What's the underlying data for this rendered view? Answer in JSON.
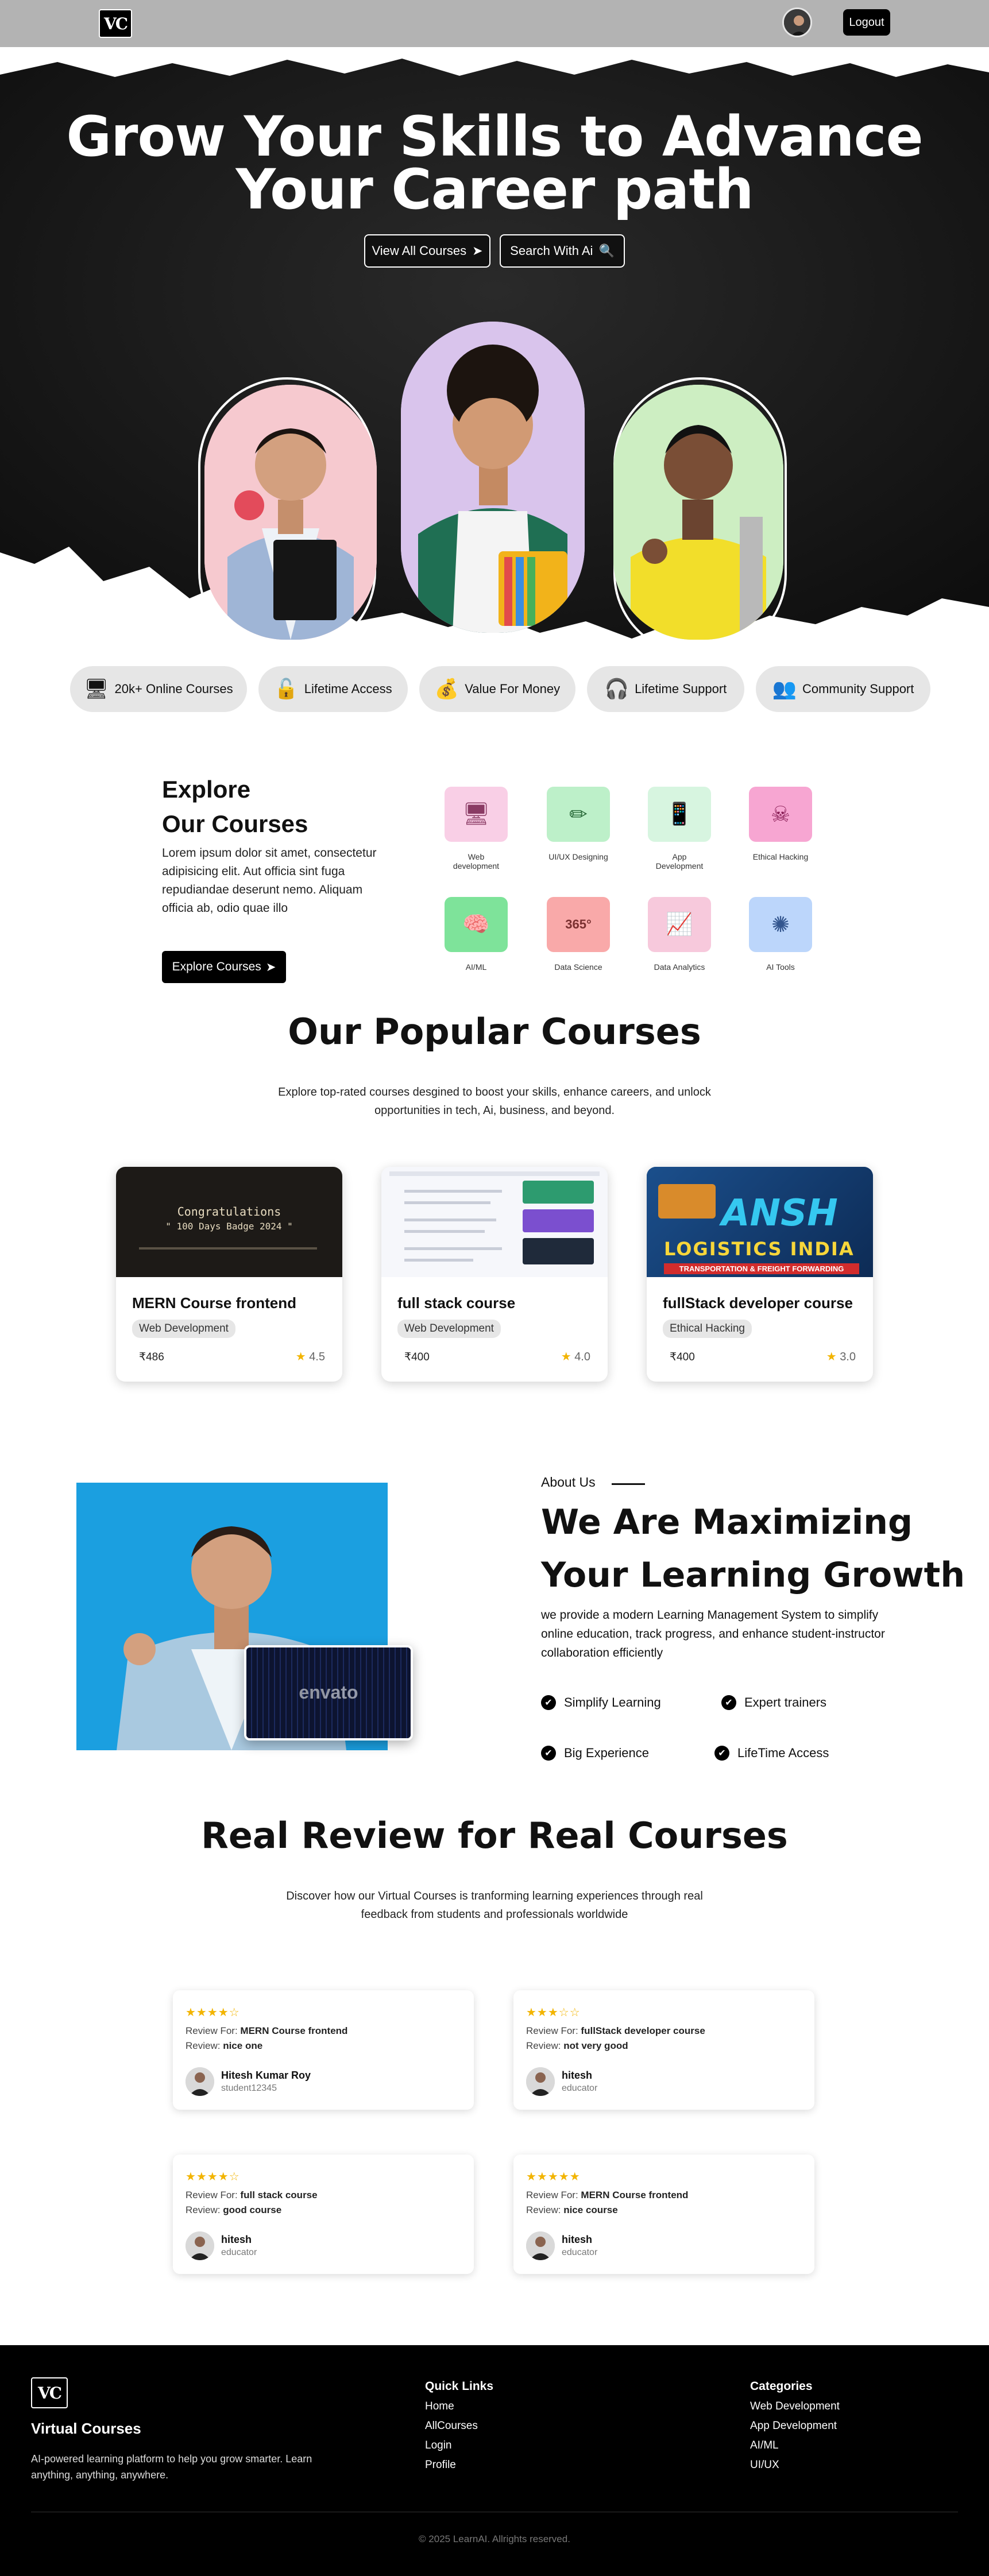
{
  "header": {
    "logo_text": "VC",
    "logout_label": "Logout"
  },
  "hero": {
    "title_line1": "Grow Your Skills to Advance",
    "title_line2": "Your Career path",
    "view_all_label": "View All Courses",
    "search_ai_label": "Search With Ai"
  },
  "features": [
    {
      "icon": "courses-icon",
      "label": "20k+ Online Courses"
    },
    {
      "icon": "lock-icon",
      "label": "Lifetime Access"
    },
    {
      "icon": "money-bag-icon",
      "label": "Value For Money"
    },
    {
      "icon": "headset-icon",
      "label": "Lifetime Support"
    },
    {
      "icon": "community-icon",
      "label": "Community Support"
    }
  ],
  "explore": {
    "title_line1": "Explore",
    "title_line2": "Our Courses",
    "description": "Lorem ipsum dolor sit amet, consectetur adipisicing elit. Aut officia sint fuga repudiandae deserunt nemo. Aliquam officia ab, odio quae illo",
    "button_label": "Explore Courses",
    "categories": [
      {
        "label": "Web development",
        "color": "#f9cfe6",
        "icon_color": "#8a3b64"
      },
      {
        "label": "UI/UX Designing",
        "color": "#bdf0c9",
        "icon_color": "#2a6b3a"
      },
      {
        "label": "App Development",
        "color": "#d7f5e0",
        "icon_color": "#3c7a50"
      },
      {
        "label": "Ethical Hacking",
        "color": "#f7a6d2",
        "icon_color": "#8a1f57"
      },
      {
        "label": "AI/ML",
        "color": "#7ee39a",
        "icon_color": "#1d6b34"
      },
      {
        "label": "Data Science",
        "color": "#f9a9a9",
        "icon_color": "#7a3030"
      },
      {
        "label": "Data Analytics",
        "color": "#f7c9dc",
        "icon_color": "#6b3a4d"
      },
      {
        "label": "AI Tools",
        "color": "#bcd6fb",
        "icon_color": "#33568f"
      }
    ]
  },
  "popular": {
    "title": "Our Popular Courses",
    "subtitle": "Explore top-rated courses desgined to boost your skills, enhance careers, and unlock opportunities in tech, Ai, business, and beyond.",
    "courses": [
      {
        "title": "MERN Course frontend",
        "category": "Web Development",
        "price": "₹486",
        "rating": "4.5"
      },
      {
        "title": "full stack course",
        "category": "Web Development",
        "price": "₹400",
        "rating": "4.0"
      },
      {
        "title": "fullStack developer course",
        "category": "Ethical Hacking",
        "price": "₹400",
        "rating": "3.0"
      }
    ],
    "thumb1_text1": "Congratulations",
    "thumb1_text2": "\" 100 Days Badge 2024 \"",
    "thumb3_brand": "ANSH",
    "thumb3_line": "LOGISTICS INDIA",
    "thumb3_tag": "TRANSPORTATION & FREIGHT FORWARDING"
  },
  "about": {
    "label": "About Us",
    "title_line1": "We Are Maximizing",
    "title_line2": "Your Learning Growth",
    "description": "we provide a modern Learning Management System to simplify online education, track progress, and enhance student-instructor collaboration efficiently",
    "points": [
      "Simplify Learning",
      "Expert trainers",
      "Big Experience",
      "LifeTime Access"
    ],
    "overlay_text": "envato"
  },
  "reviews": {
    "title": "Real Review for Real Courses",
    "subtitle": "Discover how our Virtual Courses is tranforming learning experiences through real feedback from students and professionals worldwide",
    "review_for_label": "Review For:",
    "review_label": "Review:",
    "items": [
      {
        "stars": "★★★★☆",
        "course": "MERN Course frontend",
        "review": "nice one",
        "name": "Hitesh Kumar Roy",
        "role": "student12345"
      },
      {
        "stars": "★★★☆☆",
        "course": "fullStack developer course",
        "review": "not very good",
        "name": "hitesh",
        "role": "educator"
      },
      {
        "stars": "★★★★☆",
        "course": "full stack course",
        "review": "good course",
        "name": "hitesh",
        "role": "educator"
      },
      {
        "stars": "★★★★★",
        "course": "MERN Course frontend",
        "review": "nice course",
        "name": "hitesh",
        "role": "educator"
      }
    ]
  },
  "footer": {
    "brand": "Virtual Courses",
    "tagline": "AI-powered learning platform to help you grow smarter. Learn anything, anything, anywhere.",
    "quick_links_title": "Quick Links",
    "quick_links": [
      "Home",
      "AllCourses",
      "Login",
      "Profile"
    ],
    "categories_title": "Categories",
    "categories": [
      "Web Development",
      "App Development",
      "AI/ML",
      "UI/UX"
    ],
    "copyright": "© 2025 LearnAI. Allrights reserved."
  }
}
